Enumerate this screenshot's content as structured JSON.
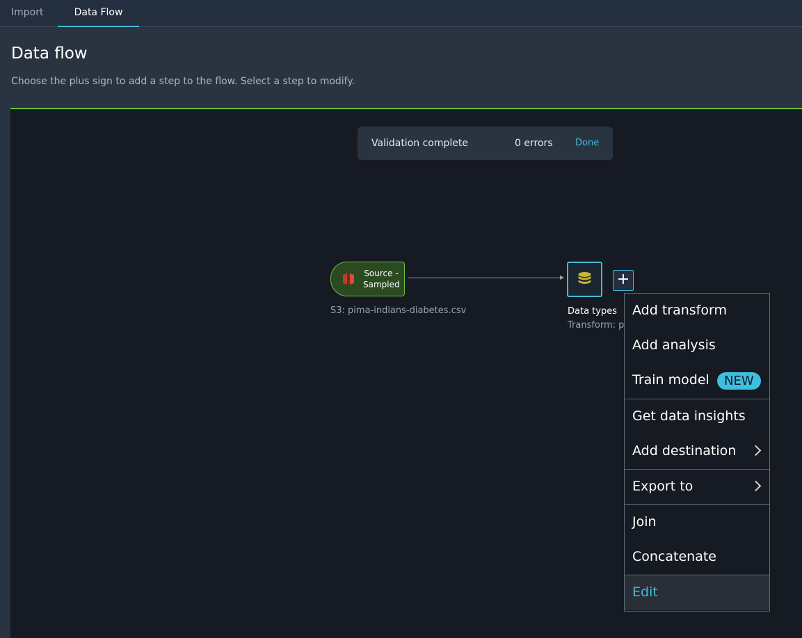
{
  "tabs": [
    {
      "label": "Import"
    },
    {
      "label": "Data Flow"
    }
  ],
  "header": {
    "title": "Data flow",
    "description": "Choose the plus sign to add a step to the flow. Select a step to modify."
  },
  "validation": {
    "text": "Validation complete",
    "errors": "0 errors",
    "done_label": "Done"
  },
  "nodes": {
    "source": {
      "label_line1": "Source -",
      "label_line2": "Sampled",
      "caption": "S3: pima-indians-diabetes.csv",
      "icon": "s3-bucket-icon"
    },
    "data_types": {
      "title": "Data types",
      "subtitle": "Transform: pi",
      "icon": "database-icon"
    },
    "plus_label": "+"
  },
  "menu": {
    "items": [
      {
        "label": "Add transform"
      },
      {
        "label": "Add analysis"
      },
      {
        "label": "Train model",
        "badge": "NEW"
      },
      {
        "label": "Get data insights"
      },
      {
        "label": "Add destination"
      },
      {
        "label": "Export to"
      },
      {
        "label": "Join"
      },
      {
        "label": "Concatenate"
      },
      {
        "label": "Edit"
      }
    ]
  },
  "colors": {
    "accent": "#44b9d6",
    "success": "#6bbf3f",
    "badge": "#3fbfe0",
    "source_icon": "#e0483b",
    "db_icon": "#c9b53a"
  }
}
